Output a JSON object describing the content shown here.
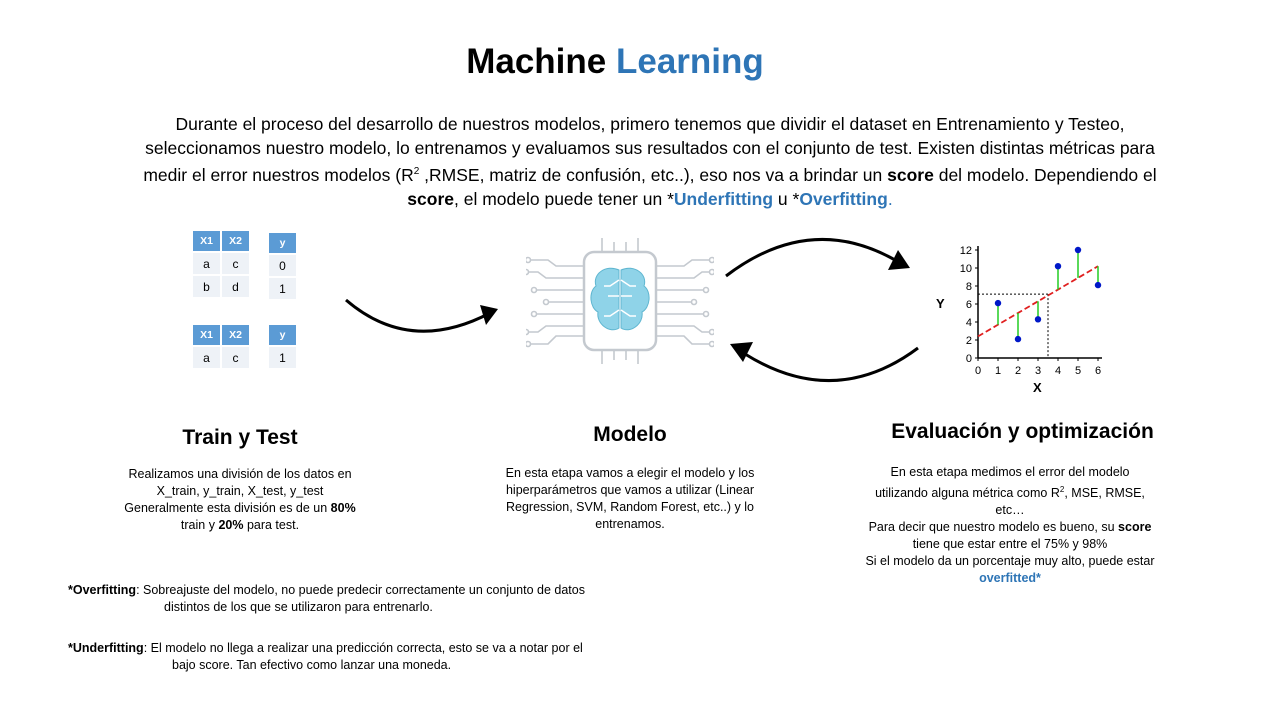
{
  "title": {
    "part1": "Machine",
    "part2": "Learning"
  },
  "intro": {
    "line1": "Durante el proceso del desarrollo de nuestros modelos, primero tenemos que dividir el dataset en Entrenamiento y Testeo,",
    "line2": "seleccionamos nuestro modelo, lo entrenamos y evaluamos sus resultados con el conjunto de test. Existen distintas métricas para",
    "line3a": "medir el error nuestros modelos (R",
    "sup": "2",
    "line3b": " ,RMSE, matriz de confusión, etc..), eso nos va a brindar un ",
    "score_word": "score",
    "line3c": " del modelo. Dependiendo el",
    "line4_score": "score",
    "line4a": ", el modelo puede tener un *",
    "underfitting": "Underfitting",
    "line4b": " u *",
    "overfitting": "Overfitting",
    "line4c": "."
  },
  "train_table": {
    "headers": [
      "X1",
      "X2"
    ],
    "rows": [
      [
        "a",
        "c"
      ],
      [
        "b",
        "d"
      ]
    ]
  },
  "train_y": {
    "header": "y",
    "rows": [
      "0",
      "1"
    ]
  },
  "test_table": {
    "headers": [
      "X1",
      "X2"
    ],
    "rows": [
      [
        "a",
        "c"
      ]
    ]
  },
  "test_y": {
    "header": "y",
    "rows": [
      "1"
    ]
  },
  "colors": {
    "accent": "#2e75b6",
    "table_header": "#5b9bd5",
    "brain": "#8fd3e8",
    "regression_line": "#e02020",
    "residual": "#22cc22",
    "point": "#0018c8"
  },
  "chart_data": {
    "type": "scatter",
    "xlabel": "X",
    "ylabel": "Y",
    "xlim": [
      0,
      6
    ],
    "ylim": [
      0,
      12
    ],
    "xticks": [
      "0",
      "1",
      "2",
      "3",
      "4",
      "5",
      "6"
    ],
    "yticks": [
      "0",
      "2",
      "4",
      "6",
      "8",
      "10",
      "12"
    ],
    "points": [
      {
        "x": 1,
        "y": 6.1
      },
      {
        "x": 2,
        "y": 2.1
      },
      {
        "x": 3,
        "y": 4.3
      },
      {
        "x": 4,
        "y": 10.2
      },
      {
        "x": 5,
        "y": 12.0
      },
      {
        "x": 6,
        "y": 8.1
      }
    ],
    "fit_line": {
      "x": [
        0,
        6
      ],
      "y": [
        2.4,
        10.2
      ]
    },
    "guide_point": {
      "x": 3.5,
      "y": 7.1
    }
  },
  "sections": {
    "train": {
      "title": "Train y Test",
      "l1": "Realizamos una división de los datos en",
      "l2": "X_train, y_train, X_test, y_test",
      "l3a": "Generalmente esta división es de un ",
      "pct1": "80%",
      "l4a": "train y ",
      "pct2": "20%",
      "l4b": " para test."
    },
    "model": {
      "title": "Modelo",
      "l1": "En esta etapa vamos a elegir el modelo y los",
      "l2": "hiperparámetros que vamos a utilizar (Linear",
      "l3": "Regression, SVM, Random Forest, etc..) y lo",
      "l4": "entrenamos."
    },
    "eval": {
      "title": "Evaluación y optimización",
      "l1": "En esta etapa medimos el error del modelo",
      "l2a": "utilizando alguna métrica como R",
      "sup": "2",
      "l2b": ", MSE, RMSE,",
      "l3": "etc…",
      "l4a": "Para decir que nuestro modelo es bueno, su ",
      "score": "score",
      "l5": "tiene que estar entre el 75% y 98%",
      "l6": "Si el modelo da un porcentaje muy alto, puede estar",
      "overfitted": "overfitted*"
    }
  },
  "notes": {
    "over_term": "*Overfitting",
    "over_a": ": Sobreajuste del modelo, no puede predecir correctamente un conjunto de datos",
    "over_b": "distintos de los que se utilizaron para entrenarlo.",
    "under_term": "*Underfitting",
    "under_a": ": El modelo no llega a realizar una predicción correcta, esto se va a notar por el",
    "under_b": "bajo score. Tan efectivo como lanzar una moneda."
  }
}
